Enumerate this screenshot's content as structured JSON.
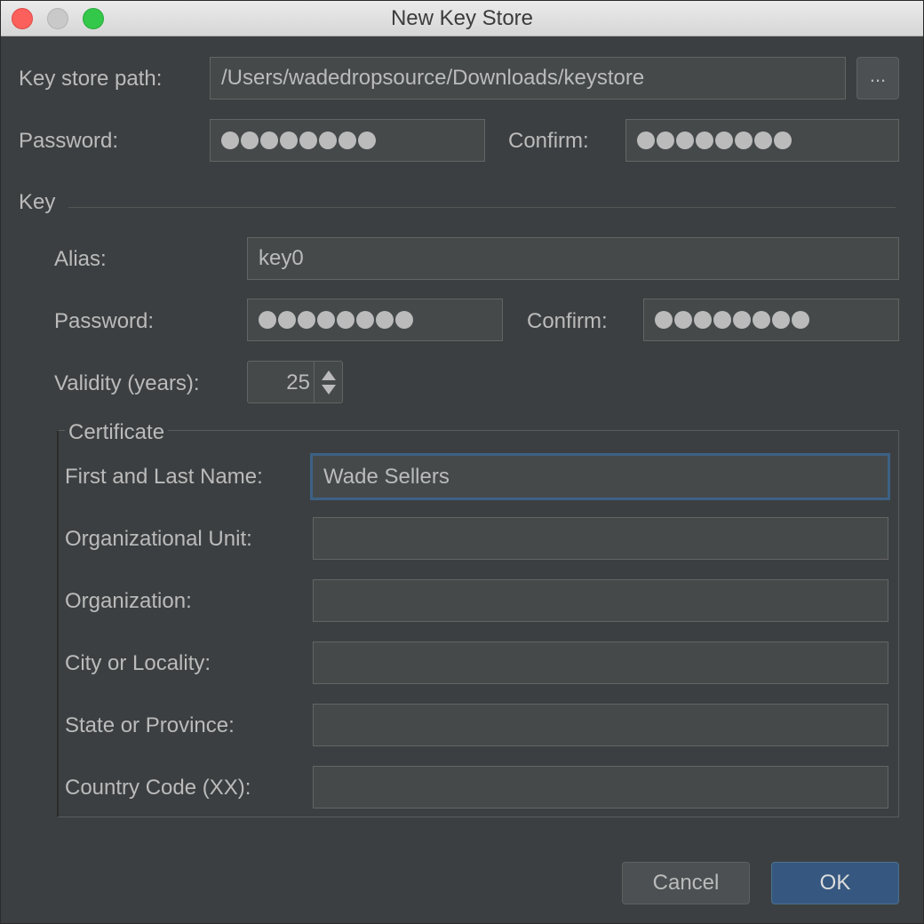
{
  "window": {
    "title": "New Key Store"
  },
  "keystore": {
    "path_label": "Key store path:",
    "path_value": "/Users/wadedropsource/Downloads/keystore",
    "browse_label": "...",
    "password_label": "Password:",
    "password_masked_length": 8,
    "confirm_label": "Confirm:",
    "confirm_masked_length": 8
  },
  "key": {
    "section_title": "Key",
    "alias_label": "Alias:",
    "alias_value": "key0",
    "password_label": "Password:",
    "password_masked_length": 8,
    "confirm_label": "Confirm:",
    "confirm_masked_length": 8,
    "validity_label": "Validity (years):",
    "validity_value": "25"
  },
  "certificate": {
    "title": "Certificate",
    "first_last_label": "First and Last Name:",
    "first_last_value": "Wade Sellers",
    "org_unit_label": "Organizational Unit:",
    "org_unit_value": "",
    "organization_label": "Organization:",
    "organization_value": "",
    "city_label": "City or Locality:",
    "city_value": "",
    "state_label": "State or Province:",
    "state_value": "",
    "country_label": "Country Code (XX):",
    "country_value": ""
  },
  "buttons": {
    "cancel_label": "Cancel",
    "ok_label": "OK"
  },
  "colors": {
    "background": "#3c3f41",
    "field_background": "#45494a",
    "text": "#bbbbbb",
    "focus_border": "#3d6185",
    "ok_button": "#365880"
  }
}
